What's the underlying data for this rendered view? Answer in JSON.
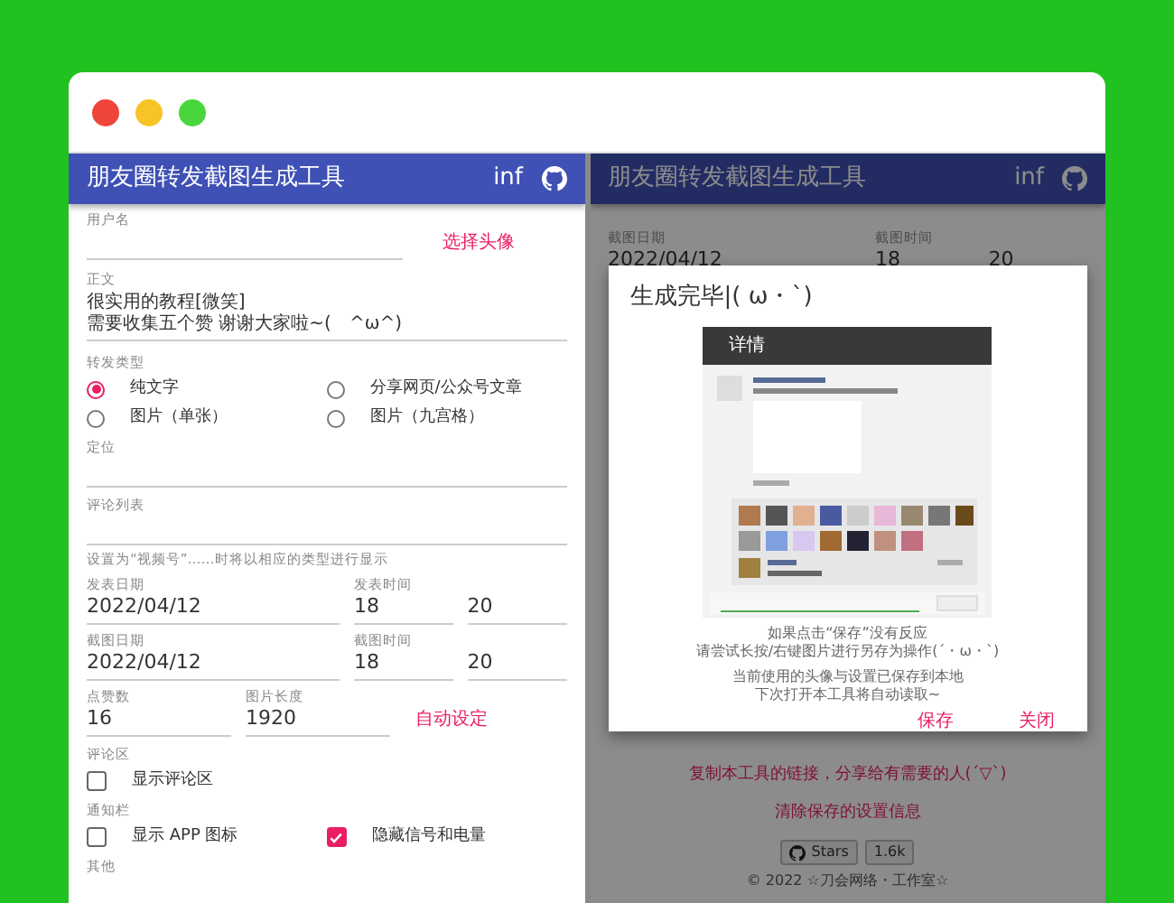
{
  "window": {
    "controls": [
      {
        "color": "#f0453a"
      },
      {
        "color": "#f7c325"
      },
      {
        "color": "#48d63c"
      }
    ]
  },
  "left_app": {
    "header": {
      "title": "朋友圈转发截图生成工具",
      "info": "inf"
    },
    "avatar_field": {
      "label": "用户名",
      "button": "选择头像"
    },
    "body_field": {
      "label": "正文",
      "lines": [
        "很实用的教程[微笑]",
        "需要收集五个赞 谢谢大家啦~(　^ω^)"
      ]
    },
    "forward_type": {
      "label": "转发类型",
      "options": [
        {
          "label": "纯文字",
          "selected": true
        },
        {
          "label": "分享网页/公众号文章",
          "selected": false
        },
        {
          "label": "图片（单张）",
          "selected": false
        },
        {
          "label": "图片（九宫格）",
          "selected": false
        }
      ]
    },
    "location_field": {
      "label": "定位"
    },
    "comment_field": {
      "label": "评论列表",
      "hint": "设置为“视频号”……时将以相应的类型进行显示"
    },
    "date_rows": [
      {
        "date_label": "发表日期",
        "date": "2022/04/12",
        "time_label": "发表时间",
        "hour": "18",
        "minute": "20"
      },
      {
        "date_label": "截图日期",
        "date": "2022/04/12",
        "time_label": "截图时间",
        "hour": "18",
        "minute": "20"
      }
    ],
    "likes": {
      "label": "点赞数",
      "value": "16"
    },
    "image_length": {
      "label": "图片长度",
      "value": "1920"
    },
    "auto_button": "自动设定",
    "comment_section": {
      "label": "评论区",
      "options": [
        {
          "label": "显示评论区",
          "checked": false
        }
      ]
    },
    "notification_bar": {
      "label": "通知栏",
      "options": [
        {
          "label": "显示 APP 图标",
          "checked": false
        },
        {
          "label": "隐藏信号和电量",
          "checked": true
        }
      ]
    },
    "other": {
      "label": "其他"
    }
  },
  "right_app": {
    "header": {
      "title": "朋友圈转发截图生成工具",
      "info": "inf"
    },
    "date_row": {
      "date_label": "截图日期",
      "date": "2022/04/12",
      "time_label": "截图时间",
      "hour": "18",
      "minute": "20"
    },
    "share_link": "复制本工具的链接，分享给有需要的人(´▽`)",
    "clear_settings": "清除保存的设置信息",
    "github_button": {
      "label": "Stars",
      "count": "1.6k"
    },
    "footer": "© 2022 ☆刀会网络・工作室☆"
  },
  "dialog": {
    "title": "生成完毕|( ω・`)",
    "preview": {
      "header": "详情"
    },
    "messages": [
      [
        "如果点击“保存”没有反应",
        "请尝试长按/右键图片进行另存为操作(´・ω・`)"
      ],
      [
        "当前使用的头像与设置已保存到本地",
        "下次打开本工具将自动读取~"
      ]
    ],
    "buttons": [
      "保存",
      "关闭"
    ]
  }
}
